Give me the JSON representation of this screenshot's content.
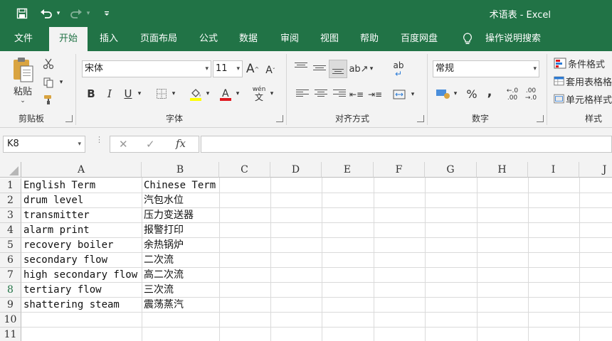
{
  "window": {
    "title": "术语表  -  Excel"
  },
  "tabs": [
    {
      "label": "文件"
    },
    {
      "label": "开始"
    },
    {
      "label": "插入"
    },
    {
      "label": "页面布局"
    },
    {
      "label": "公式"
    },
    {
      "label": "数据"
    },
    {
      "label": "审阅"
    },
    {
      "label": "视图"
    },
    {
      "label": "帮助"
    },
    {
      "label": "百度网盘"
    },
    {
      "label": "操作说明搜索"
    }
  ],
  "ribbon": {
    "clipboard": {
      "label": "剪贴板",
      "paste_label": "粘贴"
    },
    "font": {
      "label": "字体",
      "font_name": "宋体",
      "font_size": "11",
      "wen_label": "wén",
      "wen_char": "文"
    },
    "alignment": {
      "label": "对齐方式",
      "wrap_label": "ab"
    },
    "number": {
      "label": "数字",
      "format": "常规",
      "percent": "%",
      "comma": ",",
      "inc_dec": "←.0 .00",
      "dec_dec": ".00 →.0"
    },
    "styles": {
      "label": "样式",
      "items": [
        {
          "label": "条件格式"
        },
        {
          "label": "套用表格格"
        },
        {
          "label": "单元格样式"
        }
      ]
    }
  },
  "formula_bar": {
    "name_box": "K8",
    "fx": "fx",
    "value": ""
  },
  "columns": [
    "A",
    "B",
    "C",
    "D",
    "E",
    "F",
    "G",
    "H",
    "I",
    "J"
  ],
  "rows": [
    "1",
    "2",
    "3",
    "4",
    "5",
    "6",
    "7",
    "8",
    "9",
    "10",
    "11"
  ],
  "selected_row": "8",
  "cells": {
    "A": [
      "English Term",
      "drum level",
      "transmitter",
      "alarm print",
      "recovery boiler",
      "secondary flow",
      "high secondary flow",
      "tertiary flow",
      "shattering steam"
    ],
    "B": [
      "Chinese Term",
      "汽包水位",
      "压力变送器",
      "报警打印",
      "余热锅炉",
      "二次流",
      "高二次流",
      "三次流",
      "震荡蒸汽"
    ]
  },
  "colors": {
    "accent": "#217346",
    "ribbon_bg": "#f3f3f3",
    "gridline": "#dadada"
  }
}
